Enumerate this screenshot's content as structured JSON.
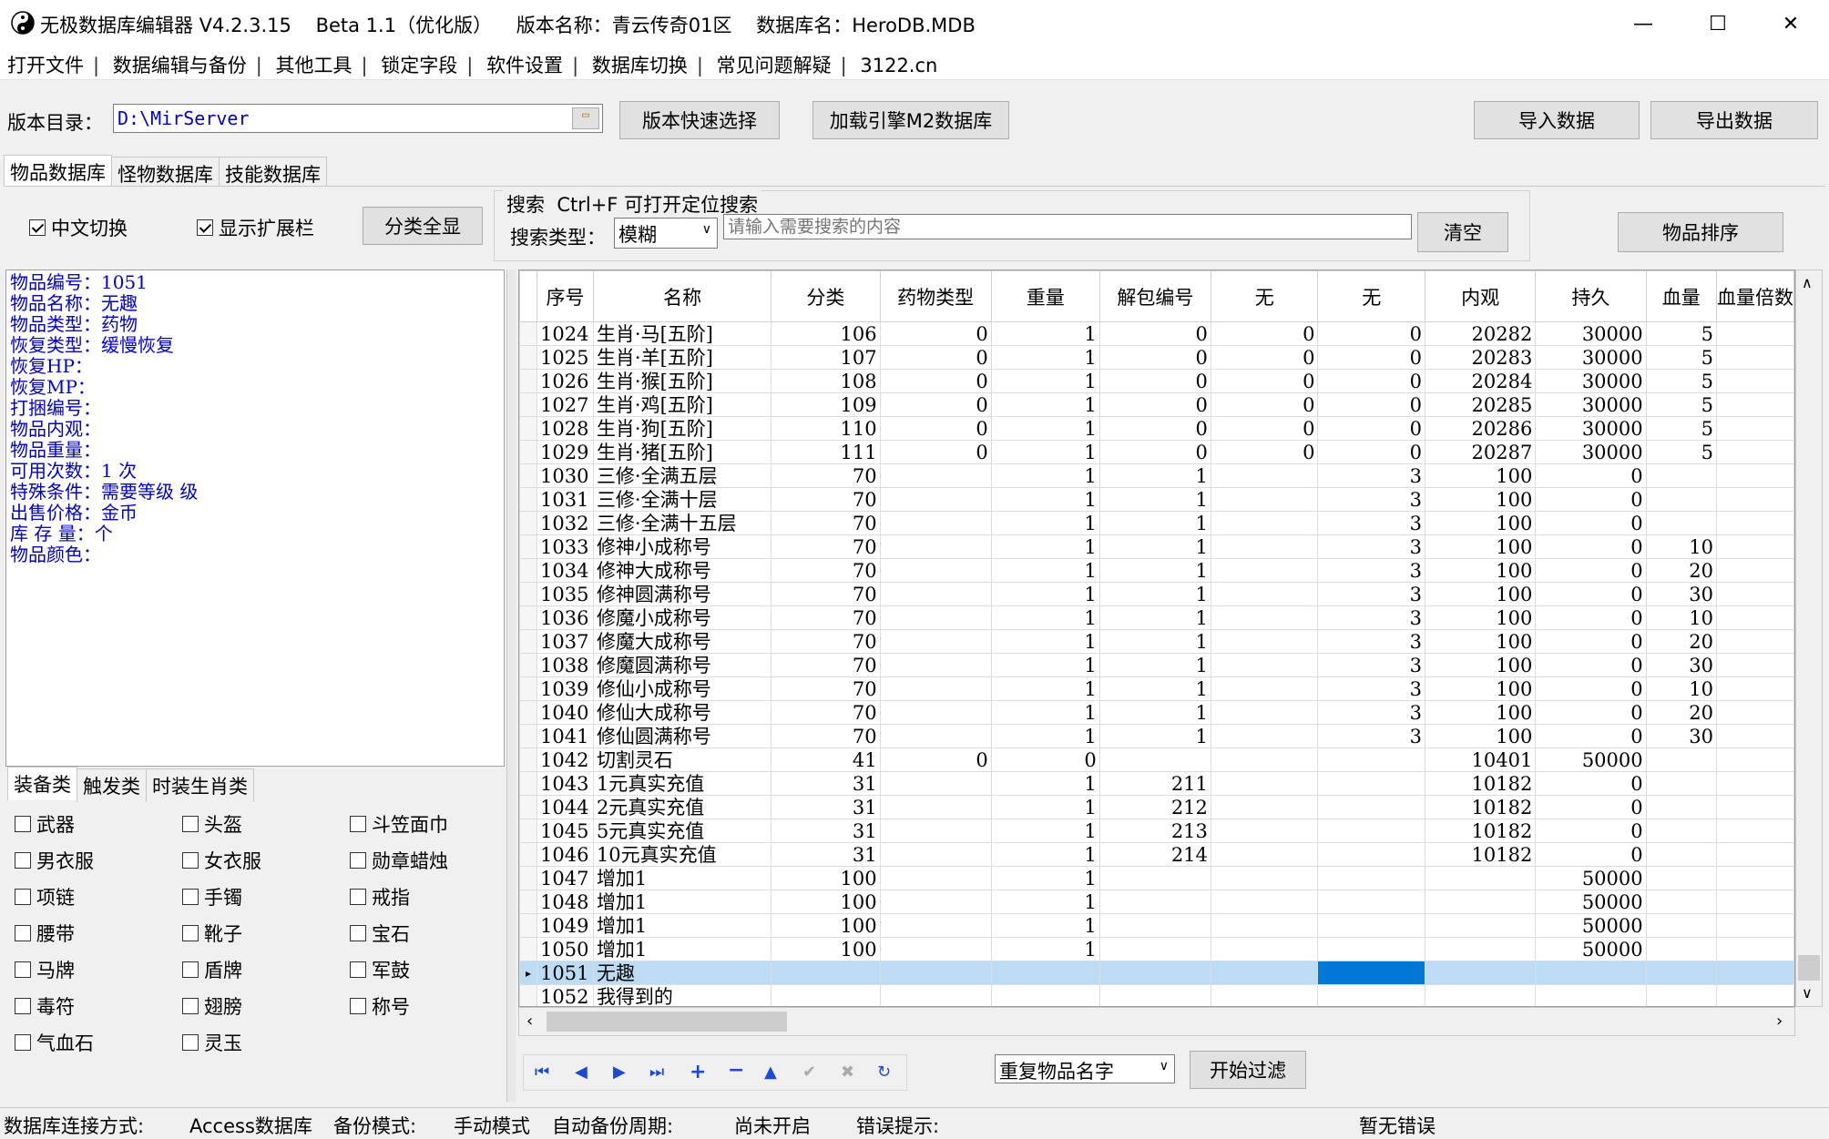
{
  "title": "无极数据库编辑器 V4.2.3.15    Beta 1.1（优化版）    版本名称：青云传奇01区    数据库名：HeroDB.MDB",
  "menu": [
    "打开文件",
    "数据编辑与备份",
    "其他工具",
    "锁定字段",
    "软件设置",
    "数据库切换",
    "常见问题解疑",
    "3122.cn"
  ],
  "toolbar": {
    "dir_label": "版本目录：",
    "dir_value": "D:\\MirServer",
    "quick_select": "版本快速选择",
    "load_m2": "加载引擎M2数据库",
    "import": "导入数据",
    "export": "导出数据"
  },
  "tabs": [
    "物品数据库",
    "怪物数据库",
    "技能数据库"
  ],
  "options": {
    "chinese": "中文切换",
    "ext": "显示扩展栏",
    "show_all": "分类全显",
    "search_title": "搜索  Ctrl+F 可打开定位搜索",
    "search_type_label": "搜索类型：",
    "search_type": "模糊",
    "search_placeholder": "请输入需要搜索的内容",
    "clear": "清空",
    "sort": "物品排序"
  },
  "info": [
    "物品编号：1051",
    "物品名称：无趣",
    "物品类型：药物",
    "恢复类型：缓慢恢复",
    "恢复HP：",
    "恢复MP：",
    "打捆编号：",
    "物品内观：",
    "物品重量：",
    "可用次数：1 次",
    "特殊条件：需要等级  级",
    "出售价格：金币",
    "库 存 量：个",
    "物品颜色："
  ],
  "cat_tabs": [
    "装备类",
    "触发类",
    "时装生肖类"
  ],
  "categories": [
    [
      "武器",
      "头盔",
      "斗笠面巾"
    ],
    [
      "男衣服",
      "女衣服",
      "勋章蜡烛"
    ],
    [
      "项链",
      "手镯",
      "戒指"
    ],
    [
      "腰带",
      "靴子",
      "宝石"
    ],
    [
      "马牌",
      "盾牌",
      "军鼓"
    ],
    [
      "毒符",
      "翅膀",
      "称号"
    ],
    [
      "气血石",
      "灵玉",
      ""
    ]
  ],
  "columns": [
    "序号",
    "名称",
    "分类",
    "药物类型",
    "重量",
    "解包编号",
    "无",
    "无",
    "内观",
    "持久",
    "血量",
    "血量倍数"
  ],
  "rows": [
    [
      "1024",
      "生肖·马[五阶]",
      "106",
      "0",
      "1",
      "0",
      "0",
      "0",
      "20282",
      "30000",
      "5"
    ],
    [
      "1025",
      "生肖·羊[五阶]",
      "107",
      "0",
      "1",
      "0",
      "0",
      "0",
      "20283",
      "30000",
      "5"
    ],
    [
      "1026",
      "生肖·猴[五阶]",
      "108",
      "0",
      "1",
      "0",
      "0",
      "0",
      "20284",
      "30000",
      "5"
    ],
    [
      "1027",
      "生肖·鸡[五阶]",
      "109",
      "0",
      "1",
      "0",
      "0",
      "0",
      "20285",
      "30000",
      "5"
    ],
    [
      "1028",
      "生肖·狗[五阶]",
      "110",
      "0",
      "1",
      "0",
      "0",
      "0",
      "20286",
      "30000",
      "5"
    ],
    [
      "1029",
      "生肖·猪[五阶]",
      "111",
      "0",
      "1",
      "0",
      "0",
      "0",
      "20287",
      "30000",
      "5"
    ],
    [
      "1030",
      "三修·全满五层",
      "70",
      "",
      "1",
      "1",
      "",
      "3",
      "100",
      "0",
      ""
    ],
    [
      "1031",
      "三修·全满十层",
      "70",
      "",
      "1",
      "1",
      "",
      "3",
      "100",
      "0",
      ""
    ],
    [
      "1032",
      "三修·全满十五层",
      "70",
      "",
      "1",
      "1",
      "",
      "3",
      "100",
      "0",
      ""
    ],
    [
      "1033",
      "修神小成称号",
      "70",
      "",
      "1",
      "1",
      "",
      "3",
      "100",
      "0",
      "10"
    ],
    [
      "1034",
      "修神大成称号",
      "70",
      "",
      "1",
      "1",
      "",
      "3",
      "100",
      "0",
      "20"
    ],
    [
      "1035",
      "修神圆满称号",
      "70",
      "",
      "1",
      "1",
      "",
      "3",
      "100",
      "0",
      "30"
    ],
    [
      "1036",
      "修魔小成称号",
      "70",
      "",
      "1",
      "1",
      "",
      "3",
      "100",
      "0",
      "10"
    ],
    [
      "1037",
      "修魔大成称号",
      "70",
      "",
      "1",
      "1",
      "",
      "3",
      "100",
      "0",
      "20"
    ],
    [
      "1038",
      "修魔圆满称号",
      "70",
      "",
      "1",
      "1",
      "",
      "3",
      "100",
      "0",
      "30"
    ],
    [
      "1039",
      "修仙小成称号",
      "70",
      "",
      "1",
      "1",
      "",
      "3",
      "100",
      "0",
      "10"
    ],
    [
      "1040",
      "修仙大成称号",
      "70",
      "",
      "1",
      "1",
      "",
      "3",
      "100",
      "0",
      "20"
    ],
    [
      "1041",
      "修仙圆满称号",
      "70",
      "",
      "1",
      "1",
      "",
      "3",
      "100",
      "0",
      "30"
    ],
    [
      "1042",
      "切割灵石",
      "41",
      "0",
      "0",
      "",
      "",
      "",
      "10401",
      "50000",
      ""
    ],
    [
      "1043",
      "1元真实充值",
      "31",
      "",
      "1",
      "211",
      "",
      "",
      "10182",
      "0",
      ""
    ],
    [
      "1044",
      "2元真实充值",
      "31",
      "",
      "1",
      "212",
      "",
      "",
      "10182",
      "0",
      ""
    ],
    [
      "1045",
      "5元真实充值",
      "31",
      "",
      "1",
      "213",
      "",
      "",
      "10182",
      "0",
      ""
    ],
    [
      "1046",
      "10元真实充值",
      "31",
      "",
      "1",
      "214",
      "",
      "",
      "10182",
      "0",
      ""
    ],
    [
      "1047",
      "增加1",
      "100",
      "",
      "1",
      "",
      "",
      "",
      "",
      "50000",
      ""
    ],
    [
      "1048",
      "增加1",
      "100",
      "",
      "1",
      "",
      "",
      "",
      "",
      "50000",
      ""
    ],
    [
      "1049",
      "增加1",
      "100",
      "",
      "1",
      "",
      "",
      "",
      "",
      "50000",
      ""
    ],
    [
      "1050",
      "增加1",
      "100",
      "",
      "1",
      "",
      "",
      "",
      "",
      "50000",
      ""
    ],
    [
      "1051",
      "无趣",
      "",
      "",
      "",
      "",
      "",
      "",
      "",
      "",
      ""
    ],
    [
      "1052",
      "我得到的",
      "",
      "",
      "",
      "",
      "",
      "",
      "",
      "",
      ""
    ]
  ],
  "selected_row": "1051",
  "filter": {
    "option": "重复物品名字",
    "button": "开始过滤"
  },
  "status": {
    "conn_label": "数据库连接方式:",
    "conn": "Access数据库",
    "backup_label": "备份模式:",
    "backup": "手动模式",
    "period_label": "自动备份周期:",
    "period": "尚未开启",
    "error_label": "错误提示:",
    "error": "暂无错误"
  },
  "colors": {
    "info_text": "#0000cc",
    "selection": "#bcdcf4",
    "highlight": "#0078d7"
  }
}
